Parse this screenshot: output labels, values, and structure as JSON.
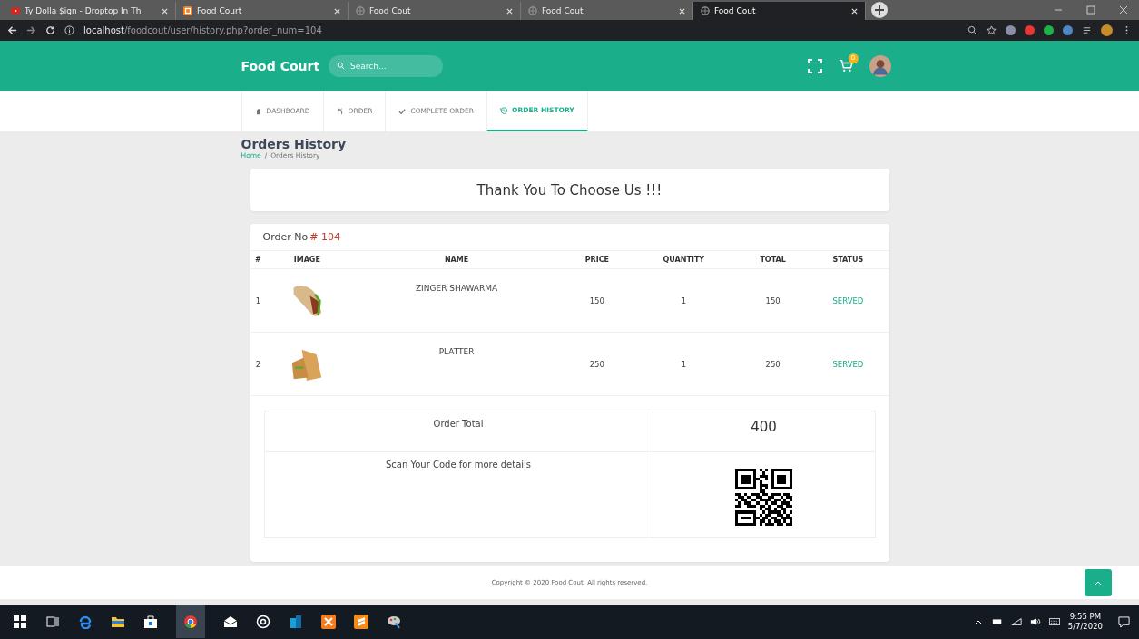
{
  "browser": {
    "tabs": [
      {
        "title": "Ty Dolla $ign - Droptop In Th",
        "kind": "video",
        "selected": false
      },
      {
        "title": "Food Court",
        "kind": "app",
        "selected": false
      },
      {
        "title": "Food Cout",
        "kind": "globe",
        "selected": false
      },
      {
        "title": "Food Cout",
        "kind": "globe",
        "selected": false
      },
      {
        "title": "Food Cout",
        "kind": "globe",
        "selected": true
      }
    ],
    "url_host": "localhost",
    "url_path": "/foodcout/user/history.php?order_num=104"
  },
  "header": {
    "brand": "Food Court",
    "search": {
      "placeholder": "Search..."
    },
    "cart_count": "0"
  },
  "nav": [
    {
      "label": "DASHBOARD",
      "kind": "home",
      "selected": false
    },
    {
      "label": "ORDER",
      "kind": "cutlery",
      "selected": false
    },
    {
      "label": "COMPLETE ORDER",
      "kind": "check",
      "selected": false
    },
    {
      "label": "ORDER HISTORY",
      "kind": "history",
      "selected": true
    }
  ],
  "page": {
    "title": "Orders History",
    "breadcrumb": {
      "home": "Home",
      "separator": "/",
      "current": "Orders History"
    }
  },
  "thanks": "Thank You To Choose Us !!!",
  "order": {
    "label": "Order No",
    "number": "# 104",
    "table": {
      "columns": [
        "#",
        "IMAGE",
        "NAME",
        "PRICE",
        "QUANTITY",
        "TOTAL",
        "STATUS"
      ],
      "rows": [
        {
          "index": "1",
          "kind": "wrap",
          "name": "ZINGER SHAWARMA",
          "price": "150",
          "quantity": "1",
          "total": "150",
          "status": "SERVED"
        },
        {
          "index": "2",
          "kind": "sandwich",
          "name": "PLATTER",
          "price": "250",
          "quantity": "1",
          "total": "250",
          "status": "SERVED"
        }
      ]
    },
    "total_label": "Order Total",
    "total_value": "400",
    "scan_text": "Scan Your Code for more details"
  },
  "footer": "Copyright © 2020 Food Cout. All rights reserved.",
  "taskbar": {
    "time": "9:55 PM",
    "date": "5/7/2020"
  }
}
